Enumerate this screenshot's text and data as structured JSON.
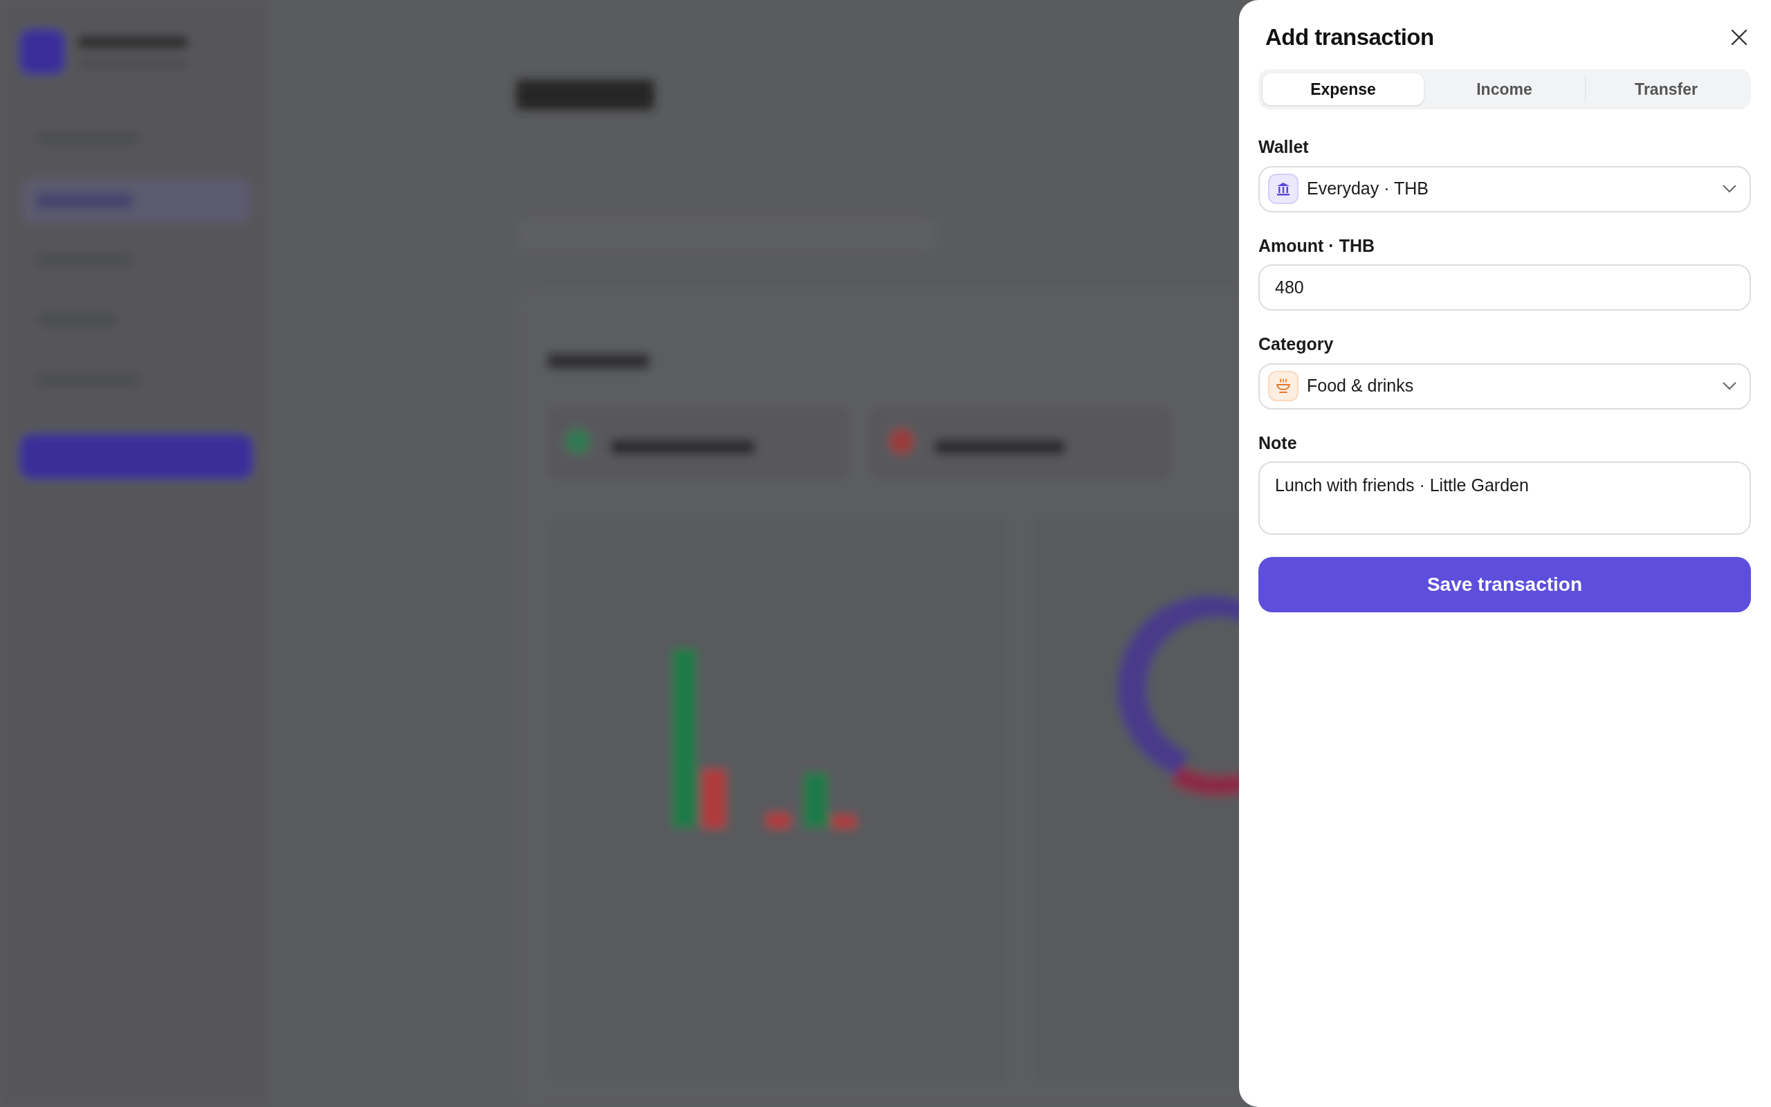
{
  "backdrop": {
    "blurred": true
  },
  "drawer": {
    "title": "Add transaction",
    "tabs": [
      {
        "label": "Expense",
        "selected": true
      },
      {
        "label": "Income",
        "selected": false
      },
      {
        "label": "Transfer",
        "selected": false
      }
    ],
    "fields": [
      {
        "kind": "select",
        "label": "Wallet",
        "value": "Everyday · THB"
      },
      {
        "kind": "input",
        "label": "Amount · THB",
        "value": "480"
      },
      {
        "kind": "select",
        "label": "Category",
        "value": "Food & drinks"
      },
      {
        "kind": "textarea",
        "label": "Note",
        "value": "Lunch with friends · Little Garden"
      }
    ],
    "submit": "Save transaction"
  }
}
